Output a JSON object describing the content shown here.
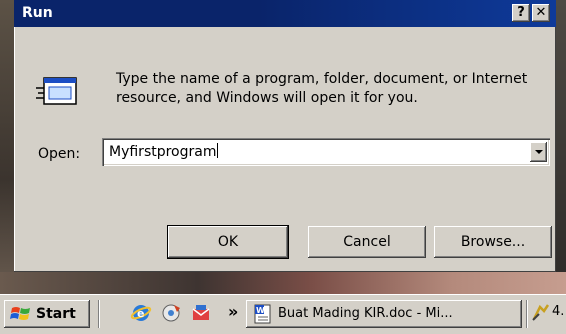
{
  "dialog": {
    "title": "Run",
    "help_label": "?",
    "close_label": "✕",
    "description": "Type the name of a program, folder, document, or Internet resource, and Windows will open it for you.",
    "open_label": "Open:",
    "open_value": "Myfirstprogram",
    "buttons": {
      "ok": "OK",
      "cancel": "Cancel",
      "browse": "Browse..."
    }
  },
  "taskbar": {
    "start_label": "Start",
    "overflow_label": "»",
    "task_button_label": "Buat Mading KIR.doc - Mi...",
    "tray_partial_text": "4."
  },
  "colors": {
    "titlebar": "#0a246a",
    "face": "#d4d0c8"
  },
  "icons": {
    "run": "run-dialog-icon",
    "start": "windows-logo-icon",
    "quicklaunch": [
      "internet-explorer-icon",
      "media-player-icon",
      "outlook-express-icon"
    ],
    "task": "word-document-icon",
    "tray": "network-icon"
  }
}
